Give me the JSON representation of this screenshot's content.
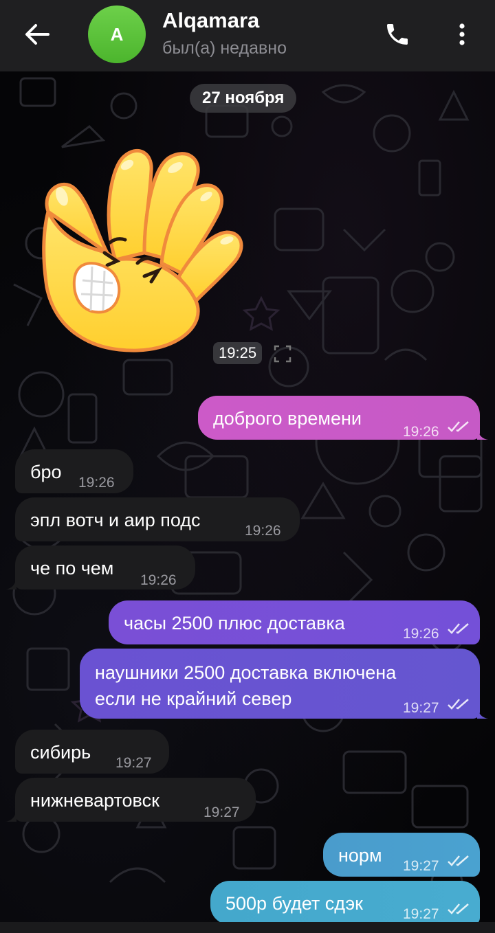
{
  "header": {
    "back_icon": "arrow-left-icon",
    "avatar_letter": "A",
    "contact_name": "Alqamara",
    "status": "был(а) недавно",
    "call_icon": "phone-icon",
    "menu_icon": "more-vertical-icon"
  },
  "date_separator": "27 ноября",
  "sticker": {
    "description_icon": "facepalm-hand-sticker",
    "time": "19:25"
  },
  "messages": [
    {
      "direction": "out",
      "text": "доброго времени",
      "time": "19:26",
      "status": "read"
    },
    {
      "direction": "in",
      "text": "бро",
      "time": "19:26"
    },
    {
      "direction": "in",
      "text": "эпл вотч и аир подс",
      "time": "19:26"
    },
    {
      "direction": "in",
      "text": "че по чем",
      "time": "19:26"
    },
    {
      "direction": "out",
      "text": "часы 2500 плюс доставка",
      "time": "19:26",
      "status": "read"
    },
    {
      "direction": "out",
      "text": "наушники 2500 доставка включена\nесли не крайний север",
      "time": "19:27",
      "status": "read"
    },
    {
      "direction": "in",
      "text": "сибирь",
      "time": "19:27"
    },
    {
      "direction": "in",
      "text": "нижневартовск",
      "time": "19:27"
    },
    {
      "direction": "out",
      "text": "норм",
      "time": "19:27",
      "status": "read"
    },
    {
      "direction": "out",
      "text": "500р будет сдэк",
      "time": "19:27",
      "status": "read"
    }
  ],
  "colors": {
    "header_bg": "#1f1f21",
    "incoming_bubble": "#1c1c1e",
    "outgoing_gradient_top": "#d060c8",
    "outgoing_gradient_mid": "#7a4fd6",
    "outgoing_gradient_bottom": "#4aa8d0",
    "avatar": "#5cc23a"
  }
}
